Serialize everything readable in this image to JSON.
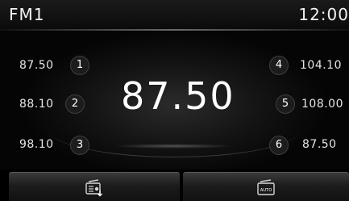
{
  "header": {
    "band": "FM1",
    "clock": "12:00"
  },
  "tuner": {
    "frequency": "87.50"
  },
  "presets": [
    {
      "number": "1",
      "frequency": "87.50"
    },
    {
      "number": "2",
      "frequency": "88.10"
    },
    {
      "number": "3",
      "frequency": "98.10"
    },
    {
      "number": "4",
      "frequency": "104.10"
    },
    {
      "number": "5",
      "frequency": "108.00"
    },
    {
      "number": "6",
      "frequency": "87.50"
    }
  ],
  "softkeys": [
    {
      "icon": "preset-save-icon"
    },
    {
      "icon": "auto-store-icon",
      "label": "AUTO"
    }
  ]
}
